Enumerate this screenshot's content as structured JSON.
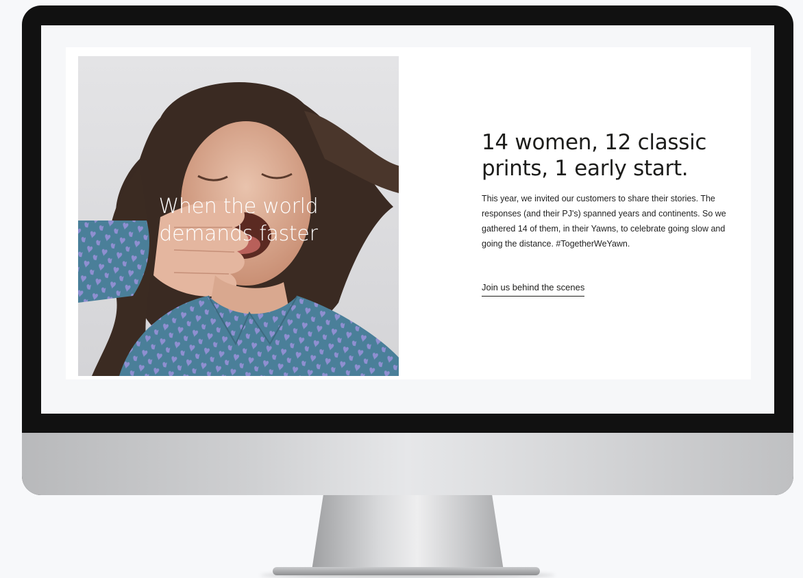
{
  "promo": {
    "photo_caption_line1": "When the world",
    "photo_caption_line2": "demands faster",
    "headline_line1": "14 women, 12 classic",
    "headline_line2": "prints, 1 early start.",
    "body": "This year, we invited our customers to share their stories. The responses (and their PJ's) spanned years and continents. So we gathered 14 of them, in their Yawns, to celebrate going slow and going the distance. #TogetherWeYawn.",
    "cta_label": "Join us behind the scenes"
  },
  "colors": {
    "text": "#1d1d1b",
    "caption": "#ffffff",
    "shirt_blue": "#4a7f99",
    "shirt_pattern": "#8f8fd1",
    "frame": "#111111"
  }
}
